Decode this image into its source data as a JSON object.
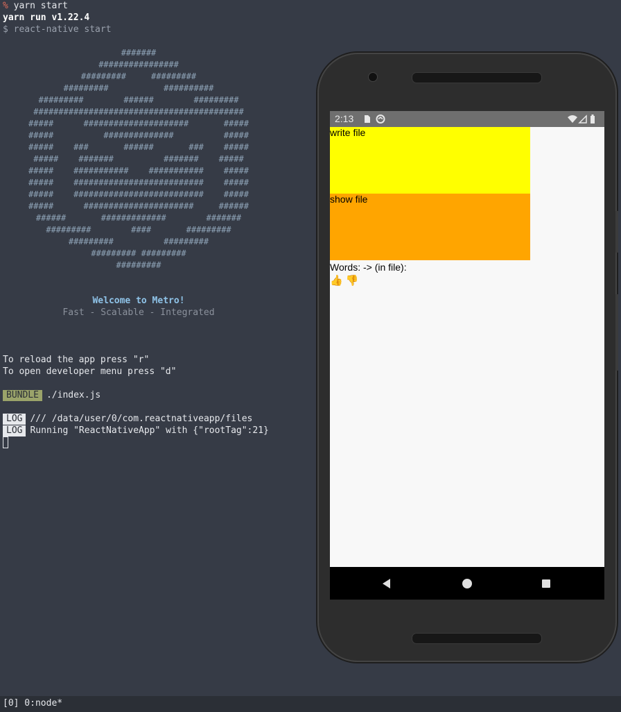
{
  "terminal": {
    "prompt_symbol": "%",
    "cmd1": "yarn start",
    "yarn_run": "yarn run v1.22.4",
    "cmd2": "$ react-native start",
    "logo_lines": [
      "#######",
      "################",
      "#########     #########",
      "#########           ##########",
      "#########        ######        #########",
      "##########################################",
      "#####      #####################       #####",
      "#####          ##############          #####",
      "#####    ###       ######       ###    #####",
      "#####    #######          #######    #####",
      "#####    ###########    ###########    #####",
      "#####    ##########################    #####",
      "#####    ##########################    #####",
      "#####      ######################     ######",
      "######       #############        #######",
      "#########        ####       #########",
      "#########          #########",
      "######### #########",
      "#########"
    ],
    "welcome": "Welcome to Metro!",
    "tagline": "Fast - Scalable - Integrated",
    "reload_hint": "To reload the app press \"r\"",
    "devmenu_hint": "To open developer menu press \"d\"",
    "bundle_tag": "BUNDLE",
    "bundle_file": "./index.js",
    "log_tag": "LOG",
    "log1": "/// /data/user/0/com.reactnativeapp/files",
    "log2": "Running \"ReactNativeApp\" with {\"rootTag\":21}"
  },
  "tmux_status": "[0] 0:node*",
  "phone": {
    "time": "2:13",
    "status_icons": [
      "sd-card-icon",
      "sync-icon"
    ],
    "right_icons": [
      "wifi-icon",
      "signal-icon",
      "battery-icon"
    ],
    "write_button_label": "write file",
    "show_button_label": "show file",
    "words_label": "Words: -> (in file):",
    "emojis": "👍 👎",
    "colors": {
      "write": "#ffff00",
      "show": "#ffa500"
    }
  }
}
